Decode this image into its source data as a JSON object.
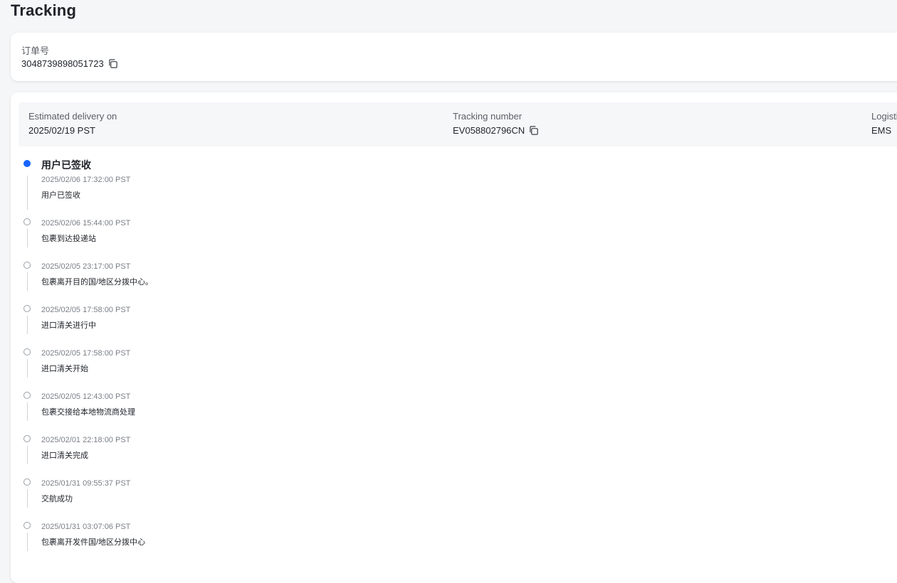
{
  "page": {
    "title": "Tracking"
  },
  "order": {
    "label": "订单号",
    "number": "3048739898051723"
  },
  "summary": {
    "estimated_label": "Estimated delivery on",
    "estimated_value": "2025/02/19 PST",
    "tracking_label": "Tracking number",
    "tracking_value": "EV058802796CN",
    "logistics_label": "Logisti",
    "logistics_value": "EMS"
  },
  "timeline": {
    "current_title": "用户已签收",
    "events": [
      {
        "time": "2025/02/06 17:32:00 PST",
        "desc": "用户已签收",
        "active": true
      },
      {
        "time": "2025/02/06 15:44:00 PST",
        "desc": "包裹到达投递站",
        "active": false
      },
      {
        "time": "2025/02/05 23:17:00 PST",
        "desc": "包裹离开目的国/地区分拨中心。",
        "active": false
      },
      {
        "time": "2025/02/05 17:58:00 PST",
        "desc": "进口清关进行中",
        "active": false
      },
      {
        "time": "2025/02/05 17:58:00 PST",
        "desc": "进口清关开始",
        "active": false
      },
      {
        "time": "2025/02/05 12:43:00 PST",
        "desc": "包裹交接给本地物流商处理",
        "active": false
      },
      {
        "time": "2025/02/01 22:18:00 PST",
        "desc": "进口清关完成",
        "active": false
      },
      {
        "time": "2025/01/31 09:55:37 PST",
        "desc": "交航成功",
        "active": false
      },
      {
        "time": "2025/01/31 03:07:06 PST",
        "desc": "包裹离开发件国/地区分拨中心",
        "active": false
      }
    ]
  },
  "colors": {
    "accent": "#1664ff",
    "page_bg": "#f5f6f8",
    "card_bg": "#ffffff",
    "summary_bg": "#f6f7f9",
    "muted_text": "#5a5f66"
  },
  "icons": {
    "copy": "copy-icon",
    "active_dot": "active-status-dot-icon",
    "inactive_dot": "status-dot-icon"
  }
}
